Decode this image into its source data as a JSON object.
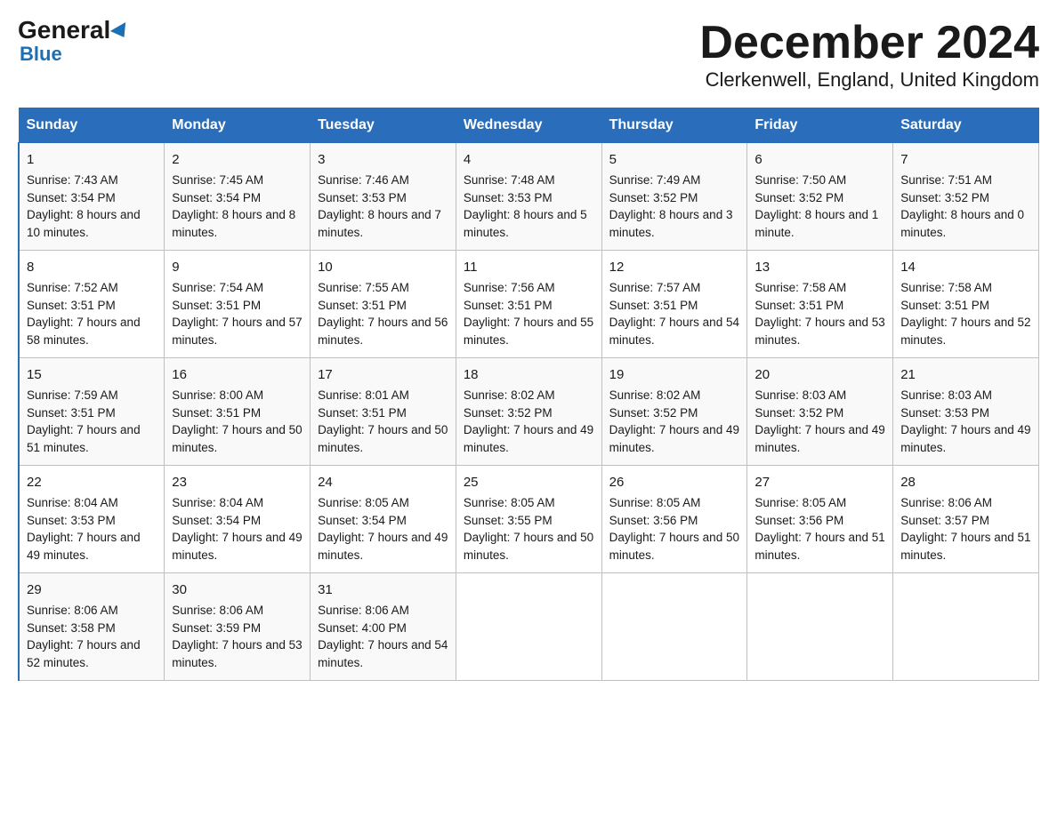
{
  "logo": {
    "line1a": "General",
    "line1b": "Blue",
    "line2": "Blue"
  },
  "title": "December 2024",
  "subtitle": "Clerkenwell, England, United Kingdom",
  "days": [
    "Sunday",
    "Monday",
    "Tuesday",
    "Wednesday",
    "Thursday",
    "Friday",
    "Saturday"
  ],
  "weeks": [
    [
      {
        "num": "1",
        "sunrise": "7:43 AM",
        "sunset": "3:54 PM",
        "daylight": "8 hours and 10 minutes."
      },
      {
        "num": "2",
        "sunrise": "7:45 AM",
        "sunset": "3:54 PM",
        "daylight": "8 hours and 8 minutes."
      },
      {
        "num": "3",
        "sunrise": "7:46 AM",
        "sunset": "3:53 PM",
        "daylight": "8 hours and 7 minutes."
      },
      {
        "num": "4",
        "sunrise": "7:48 AM",
        "sunset": "3:53 PM",
        "daylight": "8 hours and 5 minutes."
      },
      {
        "num": "5",
        "sunrise": "7:49 AM",
        "sunset": "3:52 PM",
        "daylight": "8 hours and 3 minutes."
      },
      {
        "num": "6",
        "sunrise": "7:50 AM",
        "sunset": "3:52 PM",
        "daylight": "8 hours and 1 minute."
      },
      {
        "num": "7",
        "sunrise": "7:51 AM",
        "sunset": "3:52 PM",
        "daylight": "8 hours and 0 minutes."
      }
    ],
    [
      {
        "num": "8",
        "sunrise": "7:52 AM",
        "sunset": "3:51 PM",
        "daylight": "7 hours and 58 minutes."
      },
      {
        "num": "9",
        "sunrise": "7:54 AM",
        "sunset": "3:51 PM",
        "daylight": "7 hours and 57 minutes."
      },
      {
        "num": "10",
        "sunrise": "7:55 AM",
        "sunset": "3:51 PM",
        "daylight": "7 hours and 56 minutes."
      },
      {
        "num": "11",
        "sunrise": "7:56 AM",
        "sunset": "3:51 PM",
        "daylight": "7 hours and 55 minutes."
      },
      {
        "num": "12",
        "sunrise": "7:57 AM",
        "sunset": "3:51 PM",
        "daylight": "7 hours and 54 minutes."
      },
      {
        "num": "13",
        "sunrise": "7:58 AM",
        "sunset": "3:51 PM",
        "daylight": "7 hours and 53 minutes."
      },
      {
        "num": "14",
        "sunrise": "7:58 AM",
        "sunset": "3:51 PM",
        "daylight": "7 hours and 52 minutes."
      }
    ],
    [
      {
        "num": "15",
        "sunrise": "7:59 AM",
        "sunset": "3:51 PM",
        "daylight": "7 hours and 51 minutes."
      },
      {
        "num": "16",
        "sunrise": "8:00 AM",
        "sunset": "3:51 PM",
        "daylight": "7 hours and 50 minutes."
      },
      {
        "num": "17",
        "sunrise": "8:01 AM",
        "sunset": "3:51 PM",
        "daylight": "7 hours and 50 minutes."
      },
      {
        "num": "18",
        "sunrise": "8:02 AM",
        "sunset": "3:52 PM",
        "daylight": "7 hours and 49 minutes."
      },
      {
        "num": "19",
        "sunrise": "8:02 AM",
        "sunset": "3:52 PM",
        "daylight": "7 hours and 49 minutes."
      },
      {
        "num": "20",
        "sunrise": "8:03 AM",
        "sunset": "3:52 PM",
        "daylight": "7 hours and 49 minutes."
      },
      {
        "num": "21",
        "sunrise": "8:03 AM",
        "sunset": "3:53 PM",
        "daylight": "7 hours and 49 minutes."
      }
    ],
    [
      {
        "num": "22",
        "sunrise": "8:04 AM",
        "sunset": "3:53 PM",
        "daylight": "7 hours and 49 minutes."
      },
      {
        "num": "23",
        "sunrise": "8:04 AM",
        "sunset": "3:54 PM",
        "daylight": "7 hours and 49 minutes."
      },
      {
        "num": "24",
        "sunrise": "8:05 AM",
        "sunset": "3:54 PM",
        "daylight": "7 hours and 49 minutes."
      },
      {
        "num": "25",
        "sunrise": "8:05 AM",
        "sunset": "3:55 PM",
        "daylight": "7 hours and 50 minutes."
      },
      {
        "num": "26",
        "sunrise": "8:05 AM",
        "sunset": "3:56 PM",
        "daylight": "7 hours and 50 minutes."
      },
      {
        "num": "27",
        "sunrise": "8:05 AM",
        "sunset": "3:56 PM",
        "daylight": "7 hours and 51 minutes."
      },
      {
        "num": "28",
        "sunrise": "8:06 AM",
        "sunset": "3:57 PM",
        "daylight": "7 hours and 51 minutes."
      }
    ],
    [
      {
        "num": "29",
        "sunrise": "8:06 AM",
        "sunset": "3:58 PM",
        "daylight": "7 hours and 52 minutes."
      },
      {
        "num": "30",
        "sunrise": "8:06 AM",
        "sunset": "3:59 PM",
        "daylight": "7 hours and 53 minutes."
      },
      {
        "num": "31",
        "sunrise": "8:06 AM",
        "sunset": "4:00 PM",
        "daylight": "7 hours and 54 minutes."
      },
      null,
      null,
      null,
      null
    ]
  ]
}
